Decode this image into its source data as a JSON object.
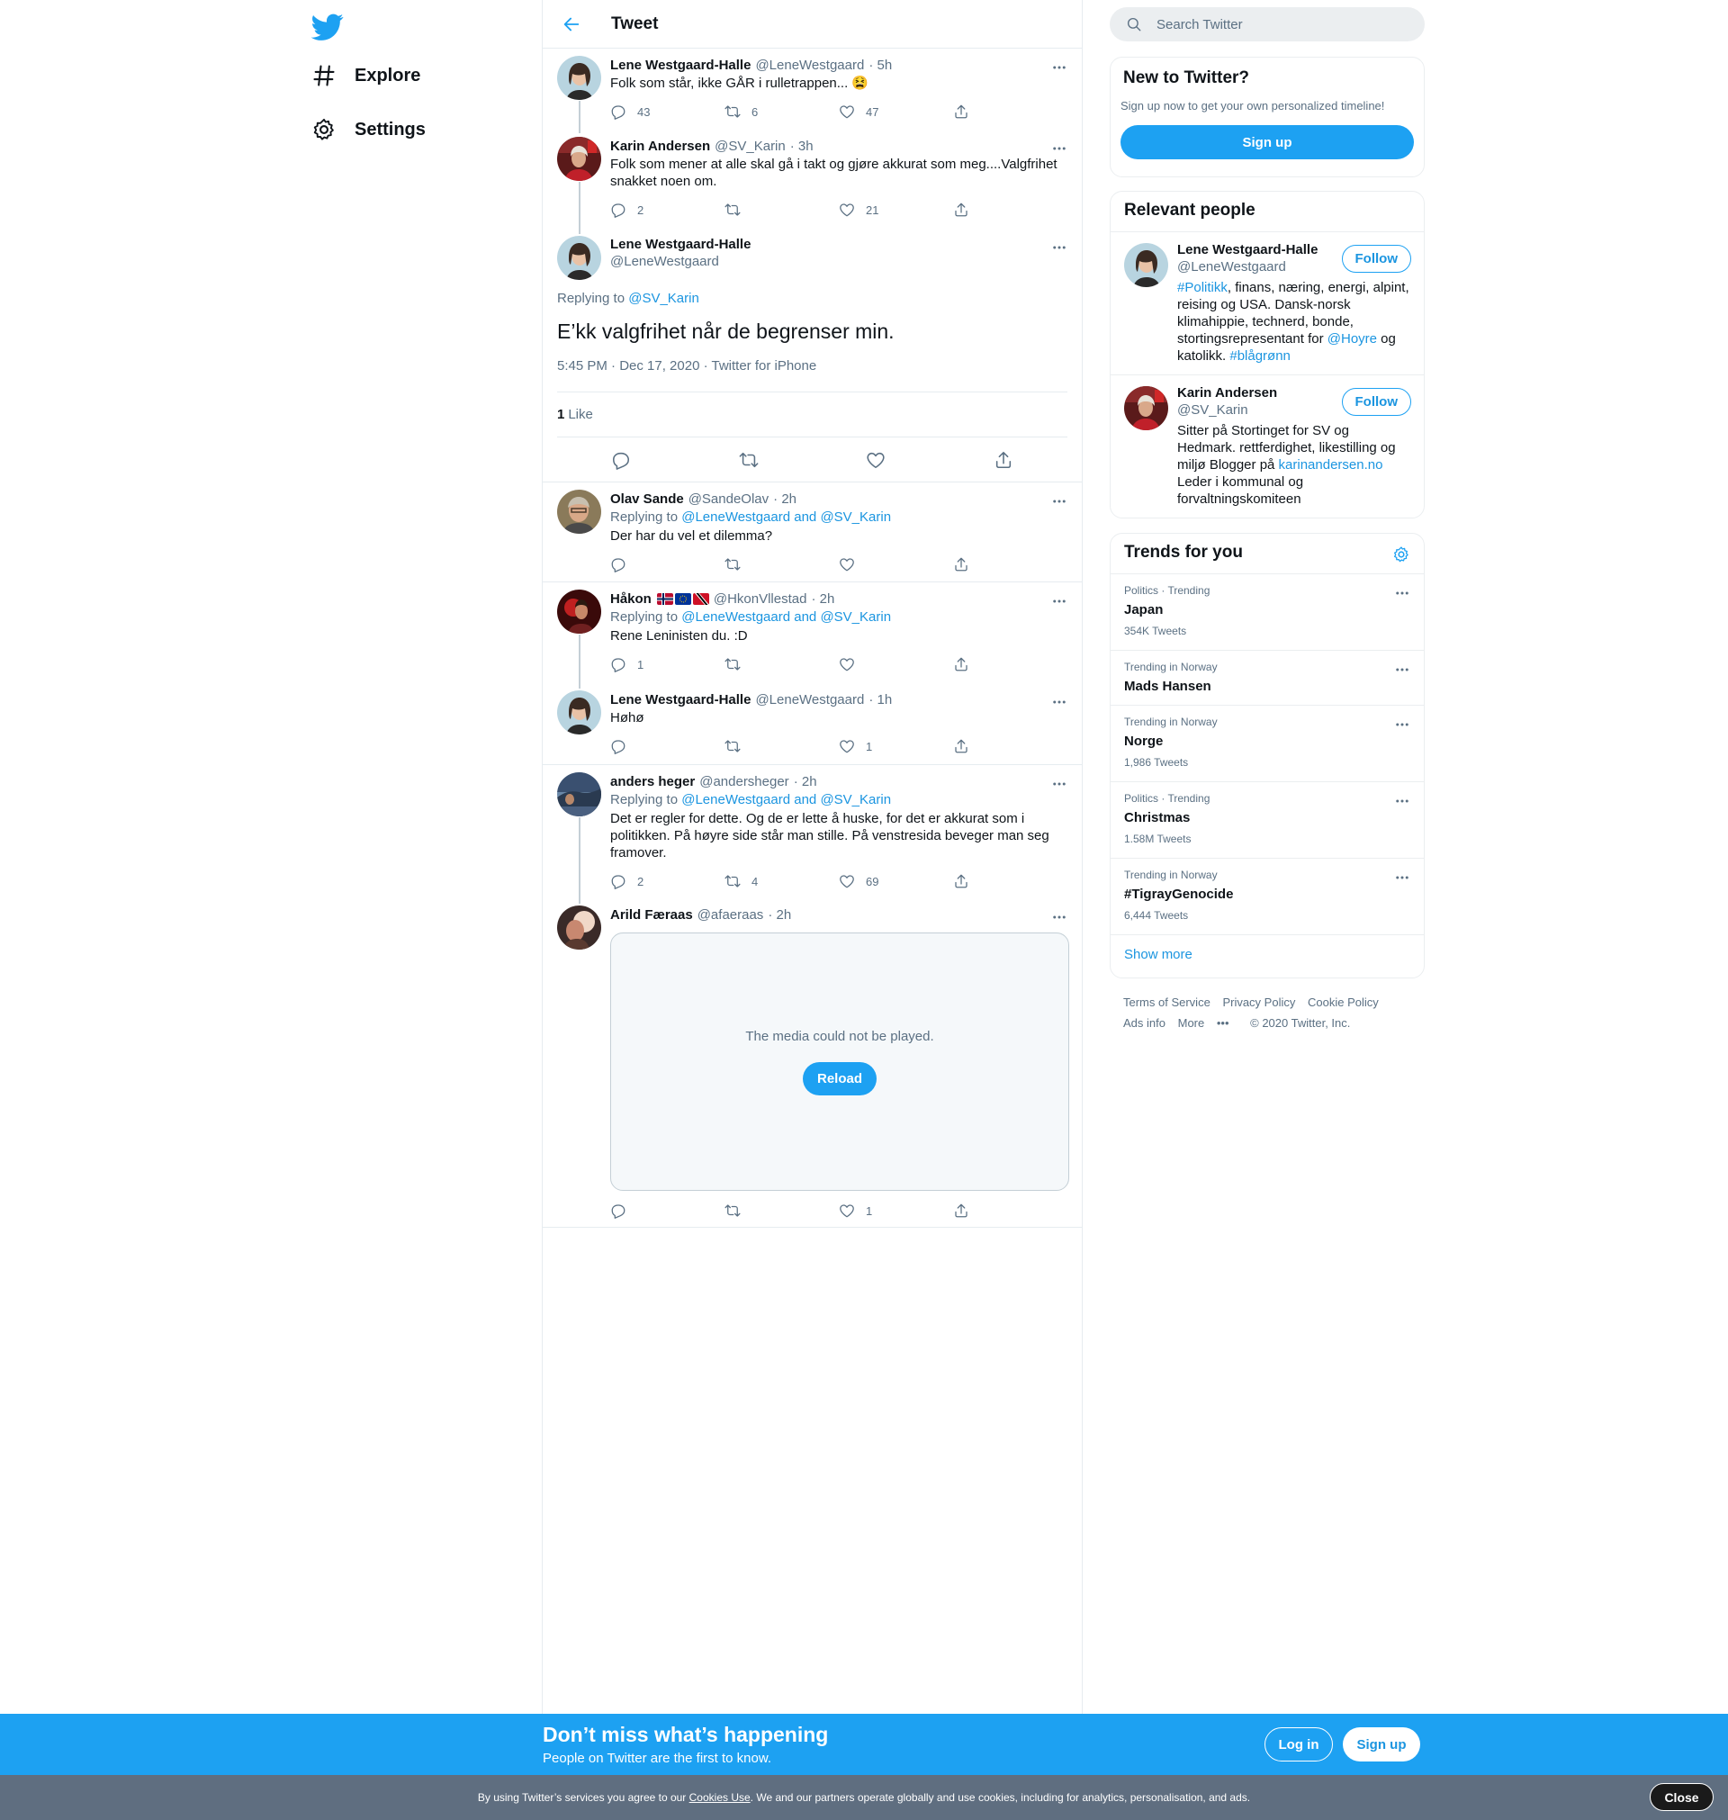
{
  "nav": {
    "explore": "Explore",
    "settings": "Settings"
  },
  "header": {
    "title": "Tweet"
  },
  "thread": [
    {
      "name": "Lene Westgaard-Halle",
      "handle": "@LeneWestgaard",
      "time": "· 5h",
      "text": "Folk som står, ikke GÅR i rulletrappen... 😫",
      "replies": "43",
      "retweets": "6",
      "likes": "47"
    },
    {
      "name": "Karin Andersen",
      "handle": "@SV_Karin",
      "time": "· 3h",
      "text": "Folk som mener at alle skal gå i takt og gjøre akkurat som meg....Valgfrihet snakket noen om.",
      "replies": "2",
      "retweets": "",
      "likes": "21"
    }
  ],
  "focal": {
    "name": "Lene Westgaard-Halle",
    "handle": "@LeneWestgaard",
    "replying_prefix": "Replying to ",
    "replying_to": "@SV_Karin",
    "text": "E’kk valgfrihet når de begrenser min.",
    "meta": "5:45 PM · Dec 17, 2020 · Twitter for iPhone",
    "like_count": "1",
    "like_label": "Like"
  },
  "replies": [
    {
      "name": "Olav Sande",
      "handle": "@SandeOlav",
      "time": "· 2h",
      "reply_prefix": "Replying to ",
      "reply_to": "@LeneWestgaard and @SV_Karin",
      "text": "Der har du vel et dilemma?",
      "replies": "",
      "retweets": "",
      "likes": ""
    },
    {
      "name": "Håkon",
      "handle": "@HkonVllestad",
      "time": "· 2h",
      "reply_prefix": "Replying to ",
      "reply_to": "@LeneWestgaard and @SV_Karin",
      "text": "Rene Leninisten du. :D",
      "replies": "1",
      "retweets": "",
      "likes": ""
    },
    {
      "name": "Lene Westgaard-Halle",
      "handle": "@LeneWestgaard",
      "time": "· 1h",
      "text": "Høhø",
      "replies": "",
      "retweets": "",
      "likes": "1"
    },
    {
      "name": "anders heger",
      "handle": "@andersheger",
      "time": "· 2h",
      "reply_prefix": "Replying to ",
      "reply_to": "@LeneWestgaard and @SV_Karin",
      "text": "Det er regler for dette. Og de er lette å huske, for det er akkurat som i politikken. På høyre side står man stille. På venstresida beveger man seg framover.",
      "replies": "2",
      "retweets": "4",
      "likes": "69"
    },
    {
      "name": "Arild Færaas",
      "handle": "@afaeraas",
      "time": "· 2h",
      "media_message": "The media could not be played.",
      "media_button": "Reload",
      "replies": "",
      "retweets": "",
      "likes": "1"
    }
  ],
  "search": {
    "placeholder": "Search Twitter"
  },
  "new_to_twitter": {
    "title": "New to Twitter?",
    "subtitle": "Sign up now to get your own personalized timeline!",
    "button": "Sign up"
  },
  "relevant_people": {
    "title": "Relevant people",
    "follow_label": "Follow",
    "people": [
      {
        "name": "Lene Westgaard-Halle",
        "handle": "@LeneWestgaard",
        "bio_1": "#Politikk",
        "bio_2": ", finans, næring, energi, alpint, reising og USA. Dansk-norsk klimahippie, technerd, bonde, stortingsrepresentant for ",
        "bio_3": "@Hoyre",
        "bio_4": " og katolikk. ",
        "bio_5": "#blågrønn"
      },
      {
        "name": "Karin Andersen",
        "handle": "@SV_Karin",
        "bio_1": "Sitter på Stortinget for SV og Hedmark. rettferdighet, likestilling og miljø Blogger på ",
        "bio_2": "karinandersen.no",
        "bio_3": " Leder i kommunal og forvaltningskomiteen"
      }
    ]
  },
  "trends": {
    "title": "Trends for you",
    "items": [
      {
        "category": "Politics · Trending",
        "name": "Japan",
        "count": "354K Tweets"
      },
      {
        "category": "Trending in Norway",
        "name": "Mads Hansen",
        "count": ""
      },
      {
        "category": "Trending in Norway",
        "name": "Norge",
        "count": "1,986 Tweets"
      },
      {
        "category": "Politics · Trending",
        "name": "Christmas",
        "count": "1.58M Tweets"
      },
      {
        "category": "Trending in Norway",
        "name": "#TigrayGenocide",
        "count": "6,444 Tweets"
      }
    ],
    "show_more": "Show more"
  },
  "footer": {
    "links": [
      "Terms of Service",
      "Privacy Policy",
      "Cookie Policy",
      "Ads info",
      "More",
      "© 2020 Twitter, Inc."
    ]
  },
  "banner": {
    "title": "Don’t miss what’s happening",
    "subtitle": "People on Twitter are the first to know.",
    "login": "Log in",
    "signup": "Sign up"
  },
  "cookie": {
    "text_1": "By using Twitter’s services you agree to our ",
    "link": "Cookies Use",
    "text_2": ". We and our partners operate globally and use cookies, including for analytics, personalisation, and ads.",
    "close": "Close"
  },
  "colors": {
    "brand": "#1da1f2",
    "link": "#1b95e0",
    "secondary_text": "#5b7083",
    "cookie_bar": "#5f6e80"
  },
  "icons": [
    "twitter-logo-icon",
    "hashtag-icon",
    "gear-icon",
    "back-arrow-icon",
    "reply-icon",
    "retweet-icon",
    "like-icon",
    "share-icon",
    "more-icon",
    "search-icon"
  ]
}
